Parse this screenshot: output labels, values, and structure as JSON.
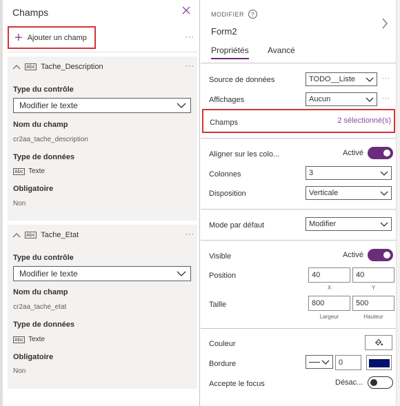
{
  "left": {
    "title": "Champs",
    "add_field_label": "Ajouter un champ",
    "more": "···",
    "cards": [
      {
        "name": "Tache_Description",
        "control_type_label": "Type du contrôle",
        "control_type_value": "Modifier le texte",
        "field_name_label": "Nom du champ",
        "field_name_value": "cr2aa_tache_description",
        "data_type_label": "Type de données",
        "data_type_value": "Texte",
        "required_label": "Obligatoire",
        "required_value": "Non"
      },
      {
        "name": "Tache_Etat",
        "control_type_label": "Type du contrôle",
        "control_type_value": "Modifier le texte",
        "field_name_label": "Nom du champ",
        "field_name_value": "cr2aa_tache_etat",
        "data_type_label": "Type de données",
        "data_type_value": "Texte",
        "required_label": "Obligatoire",
        "required_value": "Non"
      }
    ],
    "abc_icon_text": "Abc"
  },
  "right": {
    "modifier_label": "MODIFIER",
    "form_title": "Form2",
    "tabs": [
      "Propriétés",
      "Avancé"
    ],
    "source_label": "Source de données",
    "source_value": "TODO__Liste",
    "views_label": "Affichages",
    "views_value": "Aucun",
    "champs_label": "Champs",
    "champs_value": "2 sélectionné(s)",
    "snap_label": "Aligner sur les colo...",
    "snap_state": "Activé",
    "columns_label": "Colonnes",
    "columns_value": "3",
    "layout_label": "Disposition",
    "layout_value": "Verticale",
    "default_mode_label": "Mode par défaut",
    "default_mode_value": "Modifier",
    "visible_label": "Visible",
    "visible_state": "Activé",
    "position_label": "Position",
    "position_x": "40",
    "position_y": "40",
    "x_caption": "X",
    "y_caption": "Y",
    "size_label": "Taille",
    "width_value": "800",
    "height_value": "500",
    "width_caption": "Largeur",
    "height_caption": "Hauteur",
    "color_label": "Couleur",
    "border_label": "Bordure",
    "border_width": "0",
    "border_color": "#00126b",
    "focus_label": "Accepte le focus",
    "focus_state": "Désac...",
    "more": "···"
  }
}
